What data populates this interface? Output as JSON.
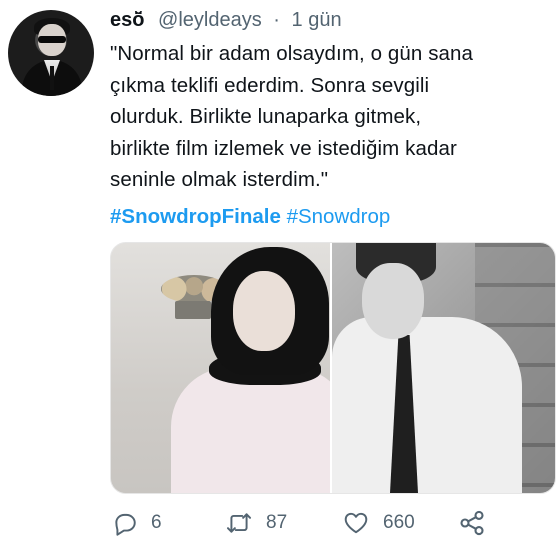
{
  "tweet": {
    "author_name": "esŏ̈",
    "handle": "@leyldeays",
    "separator": "·",
    "time": "1 gün",
    "text_lines": [
      "\"Normal bir adam olsaydım, o gün sana",
      "çıkma teklifi ederdim. Sonra sevgili",
      "olurduk. Birlikte lunaparka gitmek,",
      "birlikte film izlemek ve istediğim kadar",
      "seninle olmak isterdim.\""
    ],
    "hashtags": [
      "#SnowdropFinale",
      "#Snowdrop"
    ]
  },
  "actions": {
    "reply": {
      "icon": "reply-icon",
      "count": "6"
    },
    "retweet": {
      "icon": "retweet-icon",
      "count": "87"
    },
    "like": {
      "icon": "heart-icon",
      "count": "660"
    },
    "share": {
      "icon": "share-icon"
    }
  },
  "colors": {
    "text": "#0f1419",
    "secondary": "#536471",
    "link": "#1d9bf0",
    "background": "#ffffff"
  }
}
